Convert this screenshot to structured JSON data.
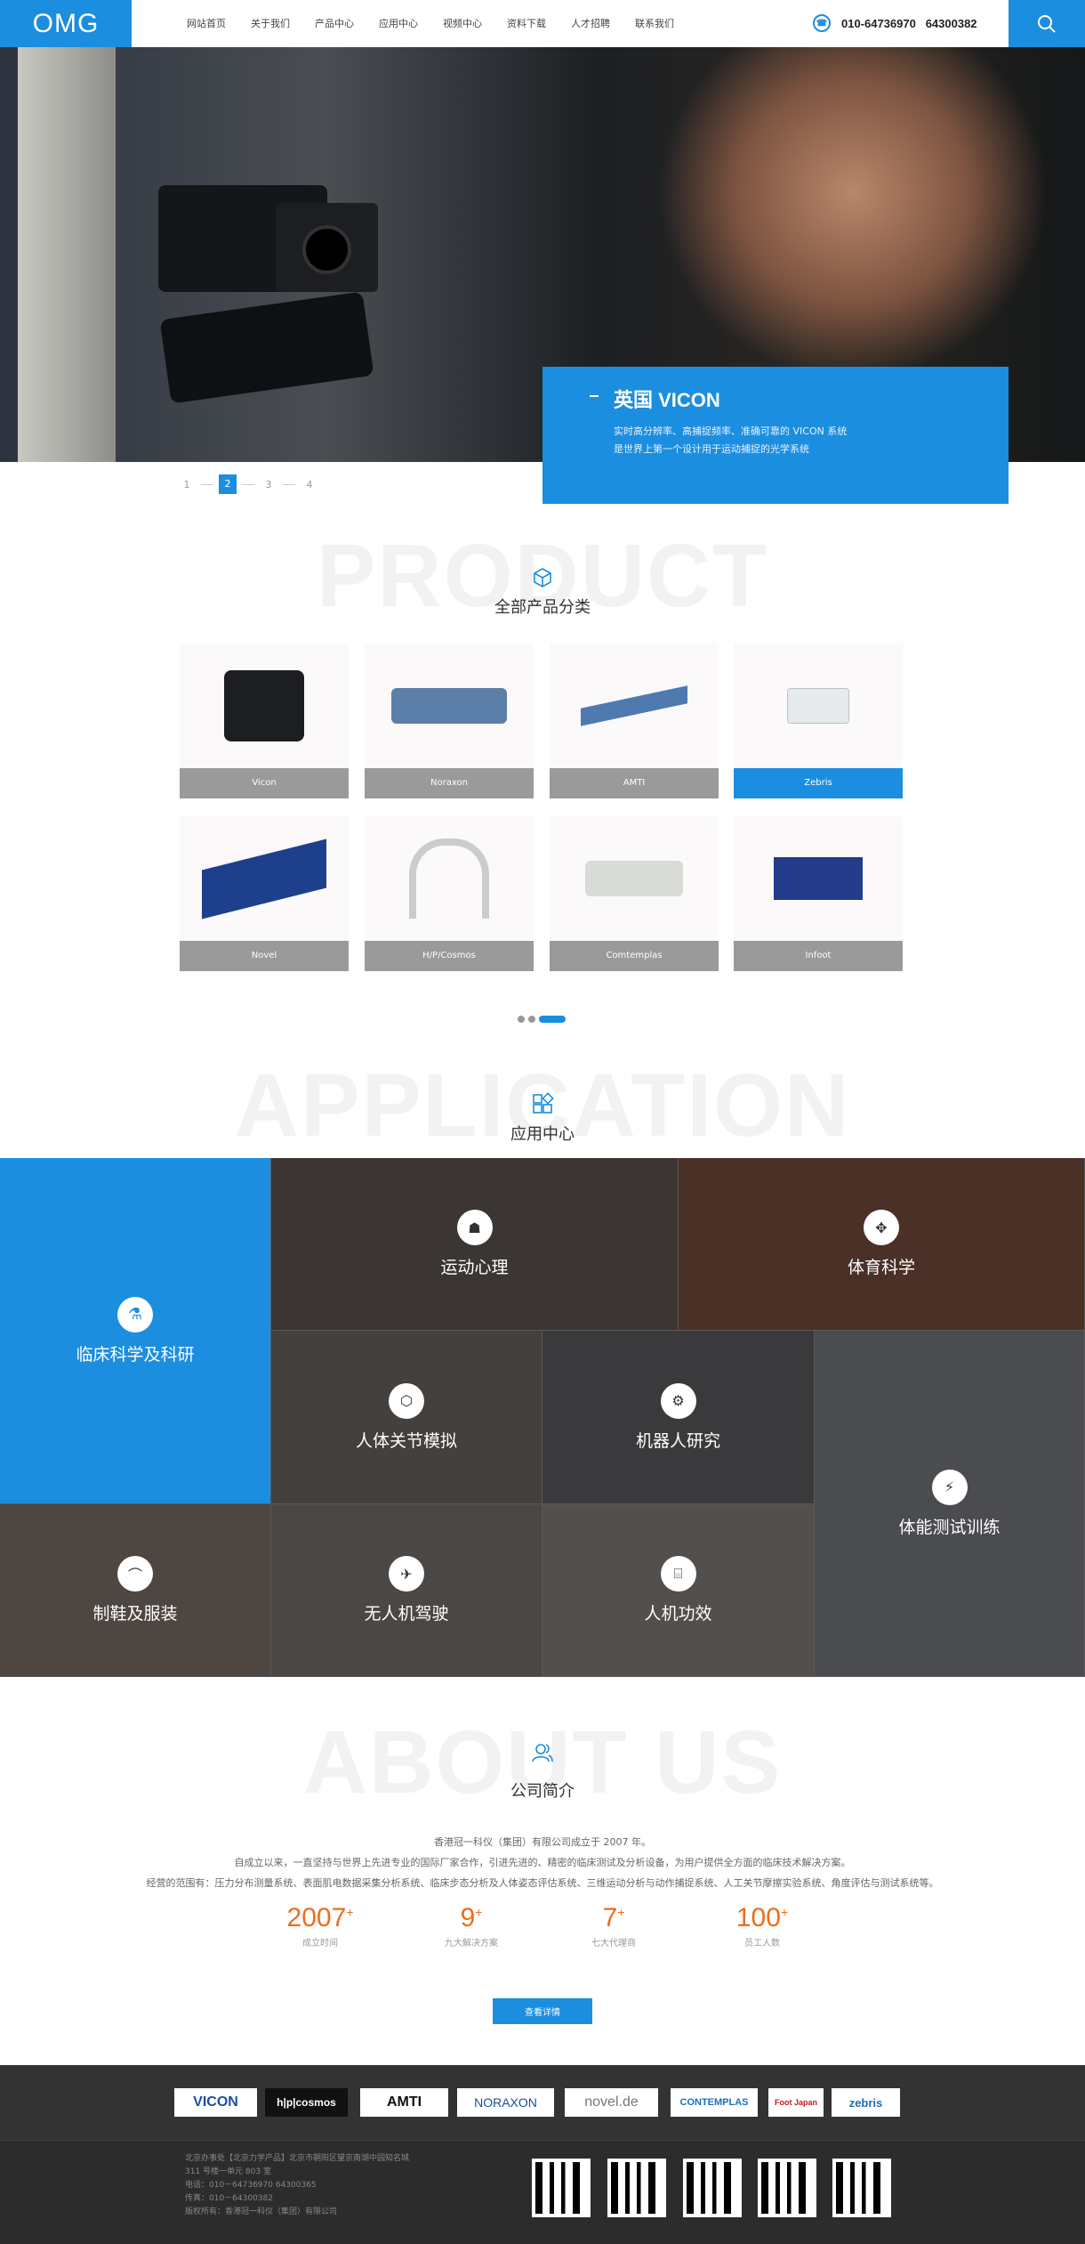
{
  "header": {
    "logo": "OMG",
    "nav": [
      "网站首页",
      "关于我们",
      "产品中心",
      "应用中心",
      "视频中心",
      "资料下载",
      "人才招聘",
      "联系我们"
    ],
    "phone": "010-64736970   64300382"
  },
  "hero": {
    "title": "英国 VICON",
    "line1": "实时高分辨率、高捕捉频率、准确可靠的 VICON 系统",
    "line2": "是世界上第一个设计用于运动捕捉的光学系统",
    "pages": [
      "1",
      "2",
      "3",
      "4"
    ],
    "active_page": "2"
  },
  "product": {
    "bg_word": "PRODUCT",
    "title": "全部产品分类",
    "items": [
      "Vicon",
      "Noraxon",
      "AMTI",
      "Zebris",
      "Novel",
      "H/P/Cosmos",
      "Comtemplas",
      "Infoot"
    ],
    "active": "Zebris"
  },
  "application": {
    "bg_word": "APPLICATION",
    "title": "应用中心",
    "items": [
      "临床科学及科研",
      "运动心理",
      "体育科学",
      "人体关节模拟",
      "机器人研究",
      "体能测试训练",
      "制鞋及服装",
      "无人机驾驶",
      "人机功效"
    ]
  },
  "about": {
    "bg_word": "ABOUT US",
    "title": "公司简介",
    "para1": "香港冠一科仪（集团）有限公司成立于 2007 年。",
    "para2": "自成立以来，一直坚持与世界上先进专业的国际厂家合作，引进先进的、精密的临床测试及分析设备，为用户提供全方面的临床技术解决方案。",
    "para3": "经营的范围有：压力分布测量系统、表面肌电数据采集分析系统、临床步态分析及人体姿态评估系统、三维运动分析与动作捕捉系统、人工关节摩擦实验系统、角度评估与测试系统等。",
    "stats": [
      {
        "num": "2007",
        "sup": "+",
        "desc": "成立时间"
      },
      {
        "num": "9",
        "sup": "+",
        "desc": "九大解决方案"
      },
      {
        "num": "7",
        "sup": "+",
        "desc": "七大代理商"
      },
      {
        "num": "100",
        "sup": "+",
        "desc": "员工人数"
      }
    ],
    "more": "查看详情"
  },
  "footer": {
    "brands": [
      "VICON",
      "h|p|cosmos",
      "AMTI",
      "NORAXON",
      "novel.de",
      "CONTEMPLAS",
      "Foot Japan",
      "zebris"
    ],
    "lines": [
      "北京办事处【北京力学产品】北京市朝阳区望京南湖中园知名城",
      "311 号楼一单元 803 室",
      "电话：010－64736970  64300365",
      "传真：010－64300382",
      "版权所有：香港冠一科仪（集团）有限公司"
    ]
  },
  "colors": {
    "accent": "#1b8ee0",
    "stat": "#ee6d1a",
    "footer": "#2c2c2c"
  }
}
